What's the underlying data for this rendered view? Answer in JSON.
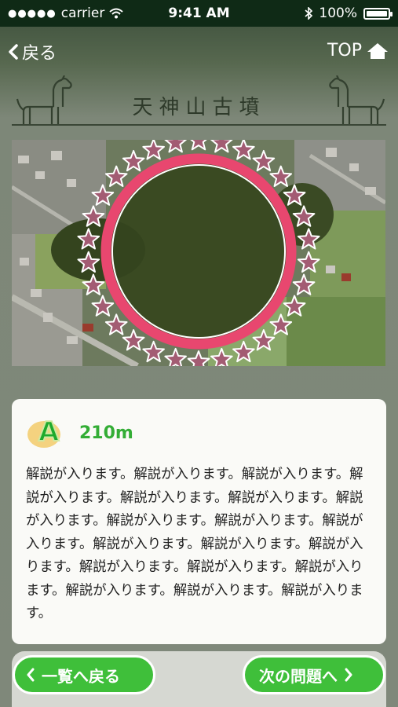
{
  "status_bar": {
    "carrier": "carrier",
    "time": "9:41 AM",
    "battery": "100%"
  },
  "nav": {
    "back_label": "戻る",
    "top_label": "TOP"
  },
  "header": {
    "title": "天神山古墳"
  },
  "card": {
    "grade": "A",
    "distance": "210m",
    "description": "解説が入ります。解説が入ります。解説が入ります。解説が入ります。解説が入ります。解説が入ります。解説が入ります。解説が入ります。解説が入ります。解説が入ります。解説が入ります。解説が入ります。解説が入ります。解説が入ります。解説が入ります。解説が入ります。解説が入ります。解説が入ります。解説が入ります。"
  },
  "footer": {
    "back_to_list_label": "一覧へ戻る",
    "next_question_label": "次の問題へ"
  },
  "colors": {
    "accent_green": "#3fbf3a",
    "ring_pink": "#e8476f",
    "star_mauve": "#a35c73"
  }
}
